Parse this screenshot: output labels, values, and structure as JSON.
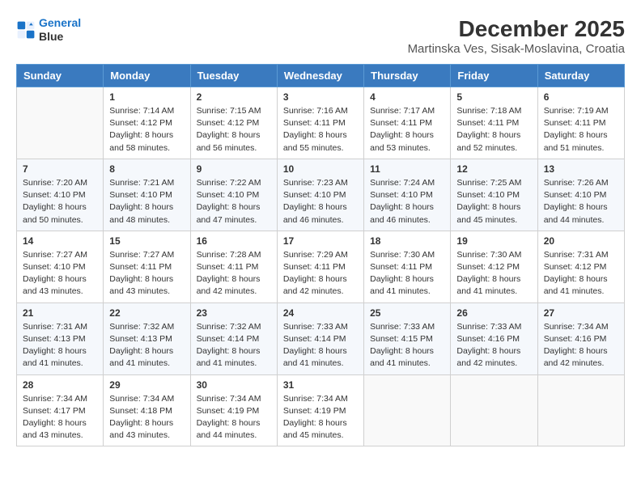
{
  "header": {
    "logo_line1": "General",
    "logo_line2": "Blue",
    "month_year": "December 2025",
    "location": "Martinska Ves, Sisak-Moslavina, Croatia"
  },
  "days_of_week": [
    "Sunday",
    "Monday",
    "Tuesday",
    "Wednesday",
    "Thursday",
    "Friday",
    "Saturday"
  ],
  "weeks": [
    [
      {
        "num": "",
        "info": ""
      },
      {
        "num": "1",
        "info": "Sunrise: 7:14 AM\nSunset: 4:12 PM\nDaylight: 8 hours\nand 58 minutes."
      },
      {
        "num": "2",
        "info": "Sunrise: 7:15 AM\nSunset: 4:12 PM\nDaylight: 8 hours\nand 56 minutes."
      },
      {
        "num": "3",
        "info": "Sunrise: 7:16 AM\nSunset: 4:11 PM\nDaylight: 8 hours\nand 55 minutes."
      },
      {
        "num": "4",
        "info": "Sunrise: 7:17 AM\nSunset: 4:11 PM\nDaylight: 8 hours\nand 53 minutes."
      },
      {
        "num": "5",
        "info": "Sunrise: 7:18 AM\nSunset: 4:11 PM\nDaylight: 8 hours\nand 52 minutes."
      },
      {
        "num": "6",
        "info": "Sunrise: 7:19 AM\nSunset: 4:11 PM\nDaylight: 8 hours\nand 51 minutes."
      }
    ],
    [
      {
        "num": "7",
        "info": "Sunrise: 7:20 AM\nSunset: 4:10 PM\nDaylight: 8 hours\nand 50 minutes."
      },
      {
        "num": "8",
        "info": "Sunrise: 7:21 AM\nSunset: 4:10 PM\nDaylight: 8 hours\nand 48 minutes."
      },
      {
        "num": "9",
        "info": "Sunrise: 7:22 AM\nSunset: 4:10 PM\nDaylight: 8 hours\nand 47 minutes."
      },
      {
        "num": "10",
        "info": "Sunrise: 7:23 AM\nSunset: 4:10 PM\nDaylight: 8 hours\nand 46 minutes."
      },
      {
        "num": "11",
        "info": "Sunrise: 7:24 AM\nSunset: 4:10 PM\nDaylight: 8 hours\nand 46 minutes."
      },
      {
        "num": "12",
        "info": "Sunrise: 7:25 AM\nSunset: 4:10 PM\nDaylight: 8 hours\nand 45 minutes."
      },
      {
        "num": "13",
        "info": "Sunrise: 7:26 AM\nSunset: 4:10 PM\nDaylight: 8 hours\nand 44 minutes."
      }
    ],
    [
      {
        "num": "14",
        "info": "Sunrise: 7:27 AM\nSunset: 4:10 PM\nDaylight: 8 hours\nand 43 minutes."
      },
      {
        "num": "15",
        "info": "Sunrise: 7:27 AM\nSunset: 4:11 PM\nDaylight: 8 hours\nand 43 minutes."
      },
      {
        "num": "16",
        "info": "Sunrise: 7:28 AM\nSunset: 4:11 PM\nDaylight: 8 hours\nand 42 minutes."
      },
      {
        "num": "17",
        "info": "Sunrise: 7:29 AM\nSunset: 4:11 PM\nDaylight: 8 hours\nand 42 minutes."
      },
      {
        "num": "18",
        "info": "Sunrise: 7:30 AM\nSunset: 4:11 PM\nDaylight: 8 hours\nand 41 minutes."
      },
      {
        "num": "19",
        "info": "Sunrise: 7:30 AM\nSunset: 4:12 PM\nDaylight: 8 hours\nand 41 minutes."
      },
      {
        "num": "20",
        "info": "Sunrise: 7:31 AM\nSunset: 4:12 PM\nDaylight: 8 hours\nand 41 minutes."
      }
    ],
    [
      {
        "num": "21",
        "info": "Sunrise: 7:31 AM\nSunset: 4:13 PM\nDaylight: 8 hours\nand 41 minutes."
      },
      {
        "num": "22",
        "info": "Sunrise: 7:32 AM\nSunset: 4:13 PM\nDaylight: 8 hours\nand 41 minutes."
      },
      {
        "num": "23",
        "info": "Sunrise: 7:32 AM\nSunset: 4:14 PM\nDaylight: 8 hours\nand 41 minutes."
      },
      {
        "num": "24",
        "info": "Sunrise: 7:33 AM\nSunset: 4:14 PM\nDaylight: 8 hours\nand 41 minutes."
      },
      {
        "num": "25",
        "info": "Sunrise: 7:33 AM\nSunset: 4:15 PM\nDaylight: 8 hours\nand 41 minutes."
      },
      {
        "num": "26",
        "info": "Sunrise: 7:33 AM\nSunset: 4:16 PM\nDaylight: 8 hours\nand 42 minutes."
      },
      {
        "num": "27",
        "info": "Sunrise: 7:34 AM\nSunset: 4:16 PM\nDaylight: 8 hours\nand 42 minutes."
      }
    ],
    [
      {
        "num": "28",
        "info": "Sunrise: 7:34 AM\nSunset: 4:17 PM\nDaylight: 8 hours\nand 43 minutes."
      },
      {
        "num": "29",
        "info": "Sunrise: 7:34 AM\nSunset: 4:18 PM\nDaylight: 8 hours\nand 43 minutes."
      },
      {
        "num": "30",
        "info": "Sunrise: 7:34 AM\nSunset: 4:19 PM\nDaylight: 8 hours\nand 44 minutes."
      },
      {
        "num": "31",
        "info": "Sunrise: 7:34 AM\nSunset: 4:19 PM\nDaylight: 8 hours\nand 45 minutes."
      },
      {
        "num": "",
        "info": ""
      },
      {
        "num": "",
        "info": ""
      },
      {
        "num": "",
        "info": ""
      }
    ]
  ]
}
